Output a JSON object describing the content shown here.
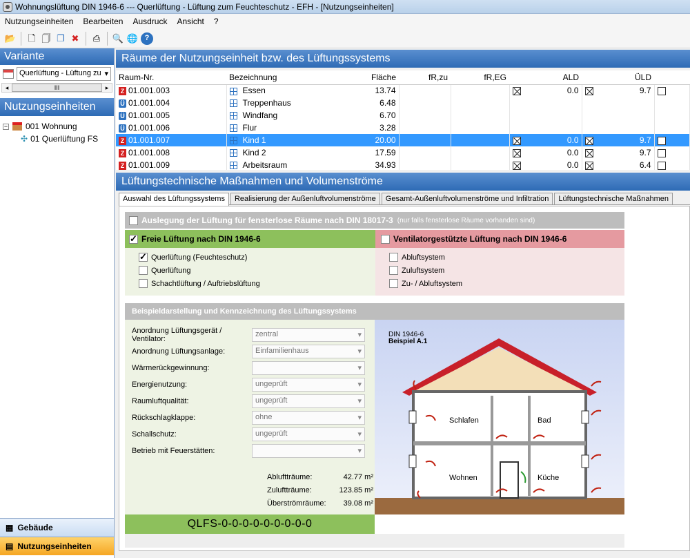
{
  "window": {
    "title": "Wohnungslüftung DIN 1946-6 --- Querlüftung - Lüftung zum Feuchteschutz - EFH - [Nutzungseinheiten]"
  },
  "menu": [
    "Nutzungseinheiten",
    "Bearbeiten",
    "Ausdruck",
    "Ansicht",
    "?"
  ],
  "left": {
    "variante_header": "Variante",
    "variante_value": "Querlüftung - Lüftung zu",
    "scroll_grip": "III",
    "nutzung_header": "Nutzungseinheiten",
    "tree_root": "001 Wohnung",
    "tree_child": "01 Querlüftung FS",
    "nav_gebaeude": "Gebäude",
    "nav_nutzung": "Nutzungseinheiten"
  },
  "rooms": {
    "header": "Räume der Nutzungseinheit bzw. des Lüftungssystems",
    "columns": [
      "Raum-Nr.",
      "Bezeichnung",
      "Fläche",
      "fR,zu",
      "fR,EG",
      "ALD",
      "ÜLD"
    ],
    "rows": [
      {
        "tag": "Z",
        "nr": "01.001.003",
        "name": "Essen",
        "flaeche": "13.74",
        "ald_chk": true,
        "ald": "0.0",
        "uld_chk": true,
        "uld": "9.7",
        "uld_box": true
      },
      {
        "tag": "Ü",
        "nr": "01.001.004",
        "name": "Treppenhaus",
        "flaeche": "6.48",
        "ald_chk": false,
        "ald": "",
        "uld_chk": false,
        "uld": "",
        "uld_box": false
      },
      {
        "tag": "Ü",
        "nr": "01.001.005",
        "name": "Windfang",
        "flaeche": "6.70",
        "ald_chk": false,
        "ald": "",
        "uld_chk": false,
        "uld": "",
        "uld_box": false
      },
      {
        "tag": "Ü",
        "nr": "01.001.006",
        "name": "Flur",
        "flaeche": "3.28",
        "ald_chk": false,
        "ald": "",
        "uld_chk": false,
        "uld": "",
        "uld_box": false
      },
      {
        "tag": "Z",
        "nr": "01.001.007",
        "name": "Kind 1",
        "flaeche": "20.00",
        "ald_chk": true,
        "ald": "0.0",
        "uld_chk": true,
        "uld": "9.7",
        "uld_box": true,
        "selected": true
      },
      {
        "tag": "Z",
        "nr": "01.001.008",
        "name": "Kind 2",
        "flaeche": "17.59",
        "ald_chk": true,
        "ald": "0.0",
        "uld_chk": true,
        "uld": "9.7",
        "uld_box": true
      },
      {
        "tag": "Z",
        "nr": "01.001.009",
        "name": "Arbeitsraum",
        "flaeche": "34.93",
        "ald_chk": true,
        "ald": "0.0",
        "uld_chk": true,
        "uld": "6.4",
        "uld_box": true
      }
    ]
  },
  "lower": {
    "header": "Lüftungstechnische Maßnahmen und Volumenströme",
    "tabs": [
      "Auswahl des Lüftungssystems",
      "Realisierung der Außenluftvolumenströme",
      "Gesamt-Außenluftvolumenströme und Infiltration",
      "Lüftungstechnische Maßnahmen"
    ],
    "fensterlos_label": "Auslegung der Lüftung für fensterlose Räume nach DIN 18017-3",
    "fensterlos_note": "(nur falls fensterlose Räume vorhanden sind)",
    "frei_label": "Freie Lüftung nach DIN 1946-6",
    "frei_options": [
      "Querlüftung (Feuchteschutz)",
      "Querlüftung",
      "Schachtlüftung / Auftriebslüftung"
    ],
    "vent_label": "Ventilatorgestützte Lüftung nach DIN 1946-6",
    "vent_options": [
      "Abluftsystem",
      "Zuluftsystem",
      "Zu- / Abluftsystem"
    ],
    "beispiel_header": "Beispieldarstellung und Kennzeichnung des Lüftungssystems",
    "fields": [
      {
        "label": "Anordnung Lüftungsgerät / Ventilator:",
        "value": "zentral"
      },
      {
        "label": "Anordnung Lüftungsanlage:",
        "value": "Einfamilienhaus"
      },
      {
        "label": "Wärmerückgewinnung:",
        "value": ""
      },
      {
        "label": "Energienutzung:",
        "value": "ungeprüft"
      },
      {
        "label": "Raumluftqualität:",
        "value": "ungeprüft"
      },
      {
        "label": "Rückschlagklappe:",
        "value": "ohne"
      },
      {
        "label": "Schallschutz:",
        "value": "ungeprüft"
      },
      {
        "label": "Betrieb mit Feuerstätten:",
        "value": ""
      }
    ],
    "summary": [
      {
        "label": "Abluftträume:",
        "value": "42.77 m²"
      },
      {
        "label": "Zuluftträume:",
        "value": "123.85 m²"
      },
      {
        "label": "Überströmräume:",
        "value": "39.08 m²"
      }
    ],
    "code": "QLFS-0-0-0-0-0-0-0-0-0",
    "diagram": {
      "norm": "DIN 1946-6",
      "example": "Beispiel A.1",
      "rooms": [
        "Schlafen",
        "Bad",
        "Wohnen",
        "Küche"
      ]
    }
  },
  "colors": {
    "accent": "#2e6bb5",
    "selected": "#3399ff",
    "green": "#8dc05c",
    "red": "#e59aa0",
    "grey_band": "#bdbdbd",
    "roof": "#c8202a"
  }
}
